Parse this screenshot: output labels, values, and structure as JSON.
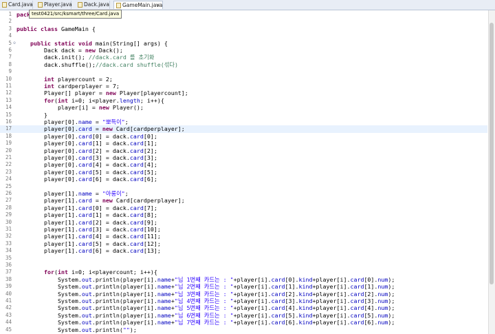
{
  "tabs": [
    {
      "label": "Card.java",
      "active": false
    },
    {
      "label": "Player.java",
      "active": false
    },
    {
      "label": "Dack.java",
      "active": false
    },
    {
      "label": "GameMain.java",
      "active": true
    }
  ],
  "tooltip": "test0421/src/ksmart/three/Card.java",
  "editor": {
    "highlighted_line": 17,
    "lines": [
      {
        "num": "1",
        "segs": [
          [
            "kw",
            "pack"
          ]
        ]
      },
      {
        "num": "2",
        "segs": []
      },
      {
        "num": "3",
        "segs": [
          [
            "kw",
            "public class "
          ],
          [
            "",
            "GameMain {"
          ]
        ]
      },
      {
        "num": "4",
        "segs": []
      },
      {
        "num": "5",
        "fold": "⊖",
        "segs": [
          [
            "",
            "    "
          ],
          [
            "kw",
            "public static void "
          ],
          [
            "",
            "main(String[] "
          ],
          [
            "",
            "args) {"
          ]
        ]
      },
      {
        "num": "6",
        "segs": [
          [
            "",
            "        Dack dack = "
          ],
          [
            "kw",
            "new "
          ],
          [
            "",
            "Dack();"
          ]
        ]
      },
      {
        "num": "7",
        "segs": [
          [
            "",
            "        dack.init(); "
          ],
          [
            "com",
            "//dack.card 를 초기화"
          ]
        ]
      },
      {
        "num": "8",
        "segs": [
          [
            "",
            "        dack.shuffle();"
          ],
          [
            "com",
            "//dack.card shuffle(섞다)"
          ]
        ]
      },
      {
        "num": "9",
        "segs": []
      },
      {
        "num": "10",
        "segs": [
          [
            "",
            "        "
          ],
          [
            "kw",
            "int "
          ],
          [
            "",
            "playercount = 2;"
          ]
        ]
      },
      {
        "num": "11",
        "segs": [
          [
            "",
            "        "
          ],
          [
            "kw",
            "int "
          ],
          [
            "",
            "cardperplayer = 7;"
          ]
        ]
      },
      {
        "num": "12",
        "segs": [
          [
            "",
            "        Player[] player = "
          ],
          [
            "kw",
            "new "
          ],
          [
            "",
            "Player[playercount];"
          ]
        ]
      },
      {
        "num": "13",
        "segs": [
          [
            "",
            "        "
          ],
          [
            "kw",
            "for"
          ],
          [
            "",
            "("
          ],
          [
            "kw",
            "int "
          ],
          [
            "",
            "i=0; i<player."
          ],
          [
            "fld",
            "length"
          ],
          [
            "",
            "; i++){"
          ]
        ]
      },
      {
        "num": "14",
        "segs": [
          [
            "",
            "            player[i] = "
          ],
          [
            "kw",
            "new "
          ],
          [
            "",
            "Player();"
          ]
        ]
      },
      {
        "num": "15",
        "segs": [
          [
            "",
            "        }"
          ]
        ]
      },
      {
        "num": "16",
        "segs": [
          [
            "",
            "        player[0]."
          ],
          [
            "fld",
            "name"
          ],
          [
            "",
            " = "
          ],
          [
            "str",
            "\"뽀득이\""
          ],
          [
            "",
            ";"
          ]
        ]
      },
      {
        "num": "17",
        "segs": [
          [
            "",
            "        player[0]."
          ],
          [
            "fld",
            "card"
          ],
          [
            "",
            " = "
          ],
          [
            "kw",
            "new "
          ],
          [
            "",
            "Card[cardperplayer];"
          ]
        ]
      },
      {
        "num": "18",
        "segs": [
          [
            "",
            "        player[0]."
          ],
          [
            "fld",
            "card"
          ],
          [
            "",
            "[0] = dack."
          ],
          [
            "fld",
            "card"
          ],
          [
            "",
            "[0];"
          ]
        ]
      },
      {
        "num": "19",
        "segs": [
          [
            "",
            "        player[0]."
          ],
          [
            "fld",
            "card"
          ],
          [
            "",
            "[1] = dack."
          ],
          [
            "fld",
            "card"
          ],
          [
            "",
            "[1];"
          ]
        ]
      },
      {
        "num": "20",
        "segs": [
          [
            "",
            "        player[0]."
          ],
          [
            "fld",
            "card"
          ],
          [
            "",
            "[2] = dack."
          ],
          [
            "fld",
            "card"
          ],
          [
            "",
            "[2];"
          ]
        ]
      },
      {
        "num": "21",
        "segs": [
          [
            "",
            "        player[0]."
          ],
          [
            "fld",
            "card"
          ],
          [
            "",
            "[3] = dack."
          ],
          [
            "fld",
            "card"
          ],
          [
            "",
            "[3];"
          ]
        ]
      },
      {
        "num": "22",
        "segs": [
          [
            "",
            "        player[0]."
          ],
          [
            "fld",
            "card"
          ],
          [
            "",
            "[4] = dack."
          ],
          [
            "fld",
            "card"
          ],
          [
            "",
            "[4];"
          ]
        ]
      },
      {
        "num": "23",
        "segs": [
          [
            "",
            "        player[0]."
          ],
          [
            "fld",
            "card"
          ],
          [
            "",
            "[5] = dack."
          ],
          [
            "fld",
            "card"
          ],
          [
            "",
            "[5];"
          ]
        ]
      },
      {
        "num": "24",
        "segs": [
          [
            "",
            "        player[0]."
          ],
          [
            "fld",
            "card"
          ],
          [
            "",
            "[6] = dack."
          ],
          [
            "fld",
            "card"
          ],
          [
            "",
            "[6];"
          ]
        ]
      },
      {
        "num": "25",
        "segs": []
      },
      {
        "num": "26",
        "segs": [
          [
            "",
            "        player[1]."
          ],
          [
            "fld",
            "name"
          ],
          [
            "",
            " = "
          ],
          [
            "str",
            "\"아롱이\""
          ],
          [
            "",
            ";"
          ]
        ]
      },
      {
        "num": "27",
        "segs": [
          [
            "",
            "        player[1]."
          ],
          [
            "fld",
            "card"
          ],
          [
            "",
            " = "
          ],
          [
            "kw",
            "new "
          ],
          [
            "",
            "Card[cardperplayer];"
          ]
        ]
      },
      {
        "num": "28",
        "segs": [
          [
            "",
            "        player[1]."
          ],
          [
            "fld",
            "card"
          ],
          [
            "",
            "[0] = dack."
          ],
          [
            "fld",
            "card"
          ],
          [
            "",
            "[7];"
          ]
        ]
      },
      {
        "num": "29",
        "segs": [
          [
            "",
            "        player[1]."
          ],
          [
            "fld",
            "card"
          ],
          [
            "",
            "[1] = dack."
          ],
          [
            "fld",
            "card"
          ],
          [
            "",
            "[8];"
          ]
        ]
      },
      {
        "num": "30",
        "segs": [
          [
            "",
            "        player[1]."
          ],
          [
            "fld",
            "card"
          ],
          [
            "",
            "[2] = dack."
          ],
          [
            "fld",
            "card"
          ],
          [
            "",
            "[9];"
          ]
        ]
      },
      {
        "num": "31",
        "segs": [
          [
            "",
            "        player[1]."
          ],
          [
            "fld",
            "card"
          ],
          [
            "",
            "[3] = dack."
          ],
          [
            "fld",
            "card"
          ],
          [
            "",
            "[10];"
          ]
        ]
      },
      {
        "num": "32",
        "segs": [
          [
            "",
            "        player[1]."
          ],
          [
            "fld",
            "card"
          ],
          [
            "",
            "[4] = dack."
          ],
          [
            "fld",
            "card"
          ],
          [
            "",
            "[11];"
          ]
        ]
      },
      {
        "num": "33",
        "segs": [
          [
            "",
            "        player[1]."
          ],
          [
            "fld",
            "card"
          ],
          [
            "",
            "[5] = dack."
          ],
          [
            "fld",
            "card"
          ],
          [
            "",
            "[12];"
          ]
        ]
      },
      {
        "num": "34",
        "segs": [
          [
            "",
            "        player[1]."
          ],
          [
            "fld",
            "card"
          ],
          [
            "",
            "[6] = dack."
          ],
          [
            "fld",
            "card"
          ],
          [
            "",
            "[13];"
          ]
        ]
      },
      {
        "num": "35",
        "segs": []
      },
      {
        "num": "36",
        "segs": []
      },
      {
        "num": "37",
        "segs": [
          [
            "",
            "        "
          ],
          [
            "kw",
            "for"
          ],
          [
            "",
            "("
          ],
          [
            "kw",
            "int "
          ],
          [
            "",
            "i=0; i<playercount; i++){"
          ]
        ]
      },
      {
        "num": "38",
        "segs": [
          [
            "",
            "            System."
          ],
          [
            "fld",
            "out"
          ],
          [
            "",
            ".println(player[i]."
          ],
          [
            "fld",
            "name"
          ],
          [
            "",
            "+"
          ],
          [
            "str",
            "\"님 1번째 카드는 : \""
          ],
          [
            "",
            "+player[i]."
          ],
          [
            "fld",
            "card"
          ],
          [
            "",
            "[0]."
          ],
          [
            "fld",
            "kind"
          ],
          [
            "",
            "+player[i]."
          ],
          [
            "fld",
            "card"
          ],
          [
            "",
            "[0]."
          ],
          [
            "fld",
            "num"
          ],
          [
            "",
            ");"
          ]
        ]
      },
      {
        "num": "39",
        "segs": [
          [
            "",
            "            System."
          ],
          [
            "fld",
            "out"
          ],
          [
            "",
            ".println(player[i]."
          ],
          [
            "fld",
            "name"
          ],
          [
            "",
            "+"
          ],
          [
            "str",
            "\"님 2번째 카드는 : \""
          ],
          [
            "",
            "+player[i]."
          ],
          [
            "fld",
            "card"
          ],
          [
            "",
            "[1]."
          ],
          [
            "fld",
            "kind"
          ],
          [
            "",
            "+player[i]."
          ],
          [
            "fld",
            "card"
          ],
          [
            "",
            "[1]."
          ],
          [
            "fld",
            "num"
          ],
          [
            "",
            ");"
          ]
        ]
      },
      {
        "num": "40",
        "segs": [
          [
            "",
            "            System."
          ],
          [
            "fld",
            "out"
          ],
          [
            "",
            ".println(player[i]."
          ],
          [
            "fld",
            "name"
          ],
          [
            "",
            "+"
          ],
          [
            "str",
            "\"님 3번째 카드는 : \""
          ],
          [
            "",
            "+player[i]."
          ],
          [
            "fld",
            "card"
          ],
          [
            "",
            "[2]."
          ],
          [
            "fld",
            "kind"
          ],
          [
            "",
            "+player[i]."
          ],
          [
            "fld",
            "card"
          ],
          [
            "",
            "[2]."
          ],
          [
            "fld",
            "num"
          ],
          [
            "",
            ");"
          ]
        ]
      },
      {
        "num": "41",
        "segs": [
          [
            "",
            "            System."
          ],
          [
            "fld",
            "out"
          ],
          [
            "",
            ".println(player[i]."
          ],
          [
            "fld",
            "name"
          ],
          [
            "",
            "+"
          ],
          [
            "str",
            "\"님 4번째 카드는 : \""
          ],
          [
            "",
            "+player[i]."
          ],
          [
            "fld",
            "card"
          ],
          [
            "",
            "[3]."
          ],
          [
            "fld",
            "kind"
          ],
          [
            "",
            "+player[i]."
          ],
          [
            "fld",
            "card"
          ],
          [
            "",
            "[3]."
          ],
          [
            "fld",
            "num"
          ],
          [
            "",
            ");"
          ]
        ]
      },
      {
        "num": "42",
        "segs": [
          [
            "",
            "            System."
          ],
          [
            "fld",
            "out"
          ],
          [
            "",
            ".println(player[i]."
          ],
          [
            "fld",
            "name"
          ],
          [
            "",
            "+"
          ],
          [
            "str",
            "\"님 5번째 카드는 : \""
          ],
          [
            "",
            "+player[i]."
          ],
          [
            "fld",
            "card"
          ],
          [
            "",
            "[4]."
          ],
          [
            "fld",
            "kind"
          ],
          [
            "",
            "+player[i]."
          ],
          [
            "fld",
            "card"
          ],
          [
            "",
            "[4]."
          ],
          [
            "fld",
            "num"
          ],
          [
            "",
            ");"
          ]
        ]
      },
      {
        "num": "43",
        "segs": [
          [
            "",
            "            System."
          ],
          [
            "fld",
            "out"
          ],
          [
            "",
            ".println(player[i]."
          ],
          [
            "fld",
            "name"
          ],
          [
            "",
            "+"
          ],
          [
            "str",
            "\"님 6번째 카드는 : \""
          ],
          [
            "",
            "+player[i]."
          ],
          [
            "fld",
            "card"
          ],
          [
            "",
            "[5]."
          ],
          [
            "fld",
            "kind"
          ],
          [
            "",
            "+player[i]."
          ],
          [
            "fld",
            "card"
          ],
          [
            "",
            "[5]."
          ],
          [
            "fld",
            "num"
          ],
          [
            "",
            ");"
          ]
        ]
      },
      {
        "num": "44",
        "segs": [
          [
            "",
            "            System."
          ],
          [
            "fld",
            "out"
          ],
          [
            "",
            ".println(player[i]."
          ],
          [
            "fld",
            "name"
          ],
          [
            "",
            "+"
          ],
          [
            "str",
            "\"님 7번째 카드는 : \""
          ],
          [
            "",
            "+player[i]."
          ],
          [
            "fld",
            "card"
          ],
          [
            "",
            "[6]."
          ],
          [
            "fld",
            "kind"
          ],
          [
            "",
            "+player[i]."
          ],
          [
            "fld",
            "card"
          ],
          [
            "",
            "[6]."
          ],
          [
            "fld",
            "num"
          ],
          [
            "",
            ");"
          ]
        ]
      },
      {
        "num": "45",
        "segs": [
          [
            "",
            "            System."
          ],
          [
            "fld",
            "out"
          ],
          [
            "",
            ".println("
          ],
          [
            "str",
            "\"\""
          ],
          [
            "",
            ");"
          ]
        ]
      }
    ]
  }
}
